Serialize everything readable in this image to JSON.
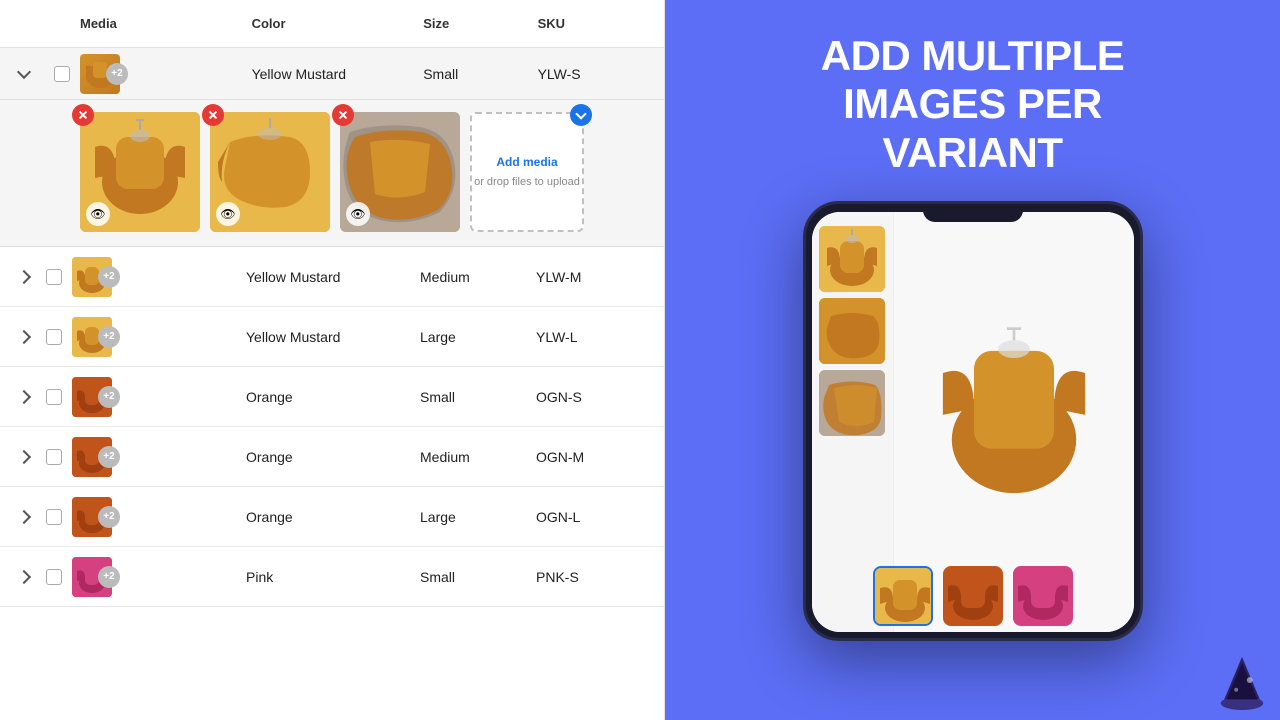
{
  "header": {
    "expand_label": "expand",
    "check_label": "check",
    "media_label": "Media",
    "color_label": "Color",
    "size_label": "Size",
    "sku_label": "SKU"
  },
  "expanded_row": {
    "color": "Yellow Mustard",
    "size": "Small",
    "sku": "YLW-S",
    "thumb_count": "+2"
  },
  "media_images": {
    "add_media_label": "Add media",
    "add_media_sub": "or drop files to upload"
  },
  "rows": [
    {
      "color": "Yellow Mustard",
      "size": "Medium",
      "sku": "YLW-M",
      "thumb_count": "+2",
      "cloth_class": "cloth-yellow"
    },
    {
      "color": "Yellow Mustard",
      "size": "Large",
      "sku": "YLW-L",
      "thumb_count": "+2",
      "cloth_class": "cloth-yellow"
    },
    {
      "color": "Orange",
      "size": "Small",
      "sku": "OGN-S",
      "thumb_count": "+2",
      "cloth_class": "cloth-orange"
    },
    {
      "color": "Orange",
      "size": "Medium",
      "sku": "OGN-M",
      "thumb_count": "+2",
      "cloth_class": "cloth-orange"
    },
    {
      "color": "Orange",
      "size": "Large",
      "sku": "OGN-L",
      "thumb_count": "+2",
      "cloth_class": "cloth-orange"
    },
    {
      "color": "Pink",
      "size": "Small",
      "sku": "PNK-S",
      "thumb_count": "+2",
      "cloth_class": "cloth-pink"
    }
  ],
  "promo": {
    "title_line1": "ADD MULTIPLE",
    "title_line2": "IMAGES PER",
    "title_line3": "VARIANT"
  },
  "phone": {
    "sidebar_thumbs": [
      "yellow",
      "yellow",
      "yellow"
    ],
    "bottom_thumbs": [
      "yellow",
      "orange",
      "pink"
    ]
  }
}
